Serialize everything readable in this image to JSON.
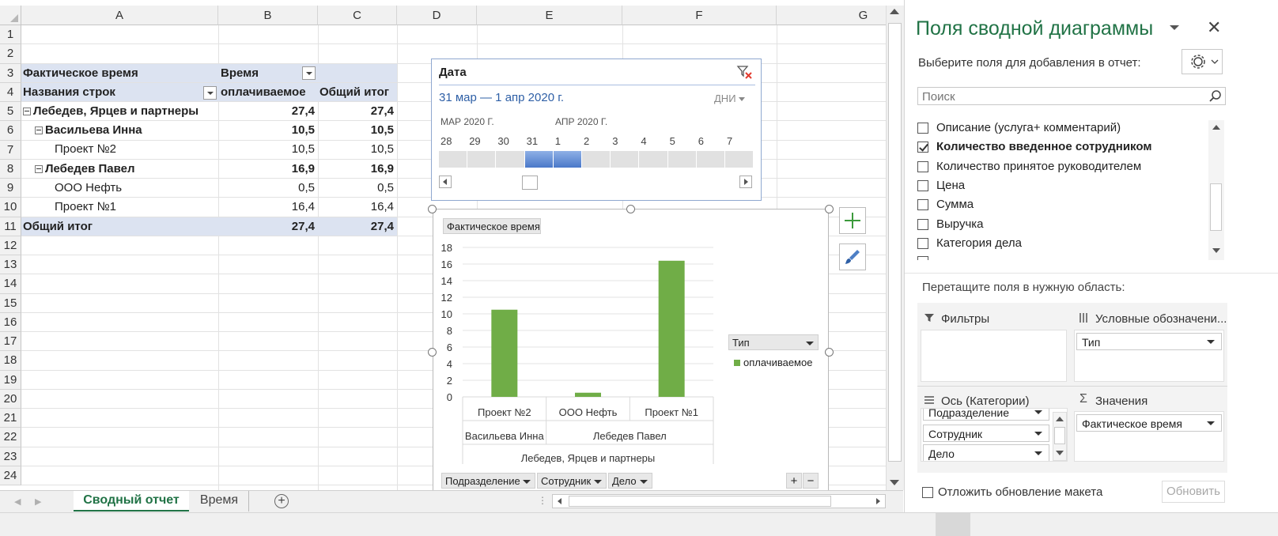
{
  "columns": [
    "A",
    "B",
    "C",
    "D",
    "E",
    "F",
    "G"
  ],
  "rows": [
    "1",
    "2",
    "3",
    "4",
    "5",
    "6",
    "7",
    "8",
    "9",
    "10",
    "11",
    "12",
    "13",
    "14",
    "15",
    "16",
    "17",
    "18",
    "19",
    "20",
    "21",
    "22",
    "23",
    "24"
  ],
  "pivot": {
    "r3": {
      "a": "Фактическое время",
      "b": "Время"
    },
    "r4": {
      "a": "Названия строк",
      "b": "оплачиваемое",
      "c": "Общий итог"
    },
    "r5": {
      "a": "Лебедев, Ярцев и партнеры",
      "b": "27,4",
      "c": "27,4"
    },
    "r6": {
      "a": "Васильева Инна",
      "b": "10,5",
      "c": "10,5"
    },
    "r7": {
      "a": "Проект №2",
      "b": "10,5",
      "c": "10,5"
    },
    "r8": {
      "a": "Лебедев Павел",
      "b": "16,9",
      "c": "16,9"
    },
    "r9": {
      "a": "ООО Нефть",
      "b": "0,5",
      "c": "0,5"
    },
    "r10": {
      "a": "Проект №1",
      "b": "16,4",
      "c": "16,4"
    },
    "r11": {
      "a": "Общий итог",
      "b": "27,4",
      "c": "27,4"
    }
  },
  "timeline": {
    "title": "Дата",
    "range": "31 мар — 1 апр 2020 г.",
    "level": "ДНИ",
    "month1": "МАР 2020 Г.",
    "month2": "АПР 2020 Г.",
    "days": [
      "28",
      "29",
      "30",
      "31",
      "1",
      "2",
      "3",
      "4",
      "5",
      "6",
      "7"
    ],
    "selected": [
      3,
      4
    ]
  },
  "chart": {
    "value_field": "Фактическое время",
    "legend_field": "Тип",
    "axis_fields": [
      "Подразделение",
      "Сотрудник",
      "Дело"
    ],
    "accent": "#70ad47"
  },
  "chart_data": {
    "type": "bar",
    "categories": [
      "Проект №2",
      "ООО Нефть",
      "Проект №1"
    ],
    "groups_level2": [
      {
        "label": "Васильева Инна",
        "span": 1
      },
      {
        "label": "Лебедев Павел",
        "span": 2
      }
    ],
    "groups_level3": [
      {
        "label": "Лебедев, Ярцев и партнеры",
        "span": 3
      }
    ],
    "series": [
      {
        "name": "оплачиваемое",
        "values": [
          10.5,
          0.5,
          16.4
        ]
      }
    ],
    "yticks": [
      "0",
      "2",
      "4",
      "6",
      "8",
      "10",
      "12",
      "14",
      "16",
      "18"
    ],
    "ylim": [
      0,
      18
    ],
    "legend": "right",
    "grid": true
  },
  "tabs": {
    "active": "Сводный отчет",
    "other": "Время"
  },
  "pane": {
    "title": "Поля сводной диаграммы",
    "subtitle": "Выберите поля для добавления в отчет:",
    "search_placeholder": "Поиск",
    "fields": [
      {
        "label": "Описание (услуга+ комментарий)",
        "checked": false
      },
      {
        "label": "Количество введенное сотрудником",
        "checked": true
      },
      {
        "label": "Количество принятое руководителем",
        "checked": false
      },
      {
        "label": "Цена",
        "checked": false
      },
      {
        "label": "Сумма",
        "checked": false
      },
      {
        "label": "Выручка",
        "checked": false
      },
      {
        "label": "Категория дела",
        "checked": false
      }
    ],
    "drag_hint": "Перетащите поля в нужную область:",
    "filters_label": "Фильтры",
    "legend_label": "Условные обозначени...",
    "legend_item": "Тип",
    "axis_label": "Ось (Категории)",
    "axis_items": [
      "Подразделение",
      "Сотрудник",
      "Дело"
    ],
    "values_label": "Значения",
    "values_item": "Фактическое время",
    "defer_label": "Отложить обновление макета",
    "update_label": "Обновить"
  }
}
